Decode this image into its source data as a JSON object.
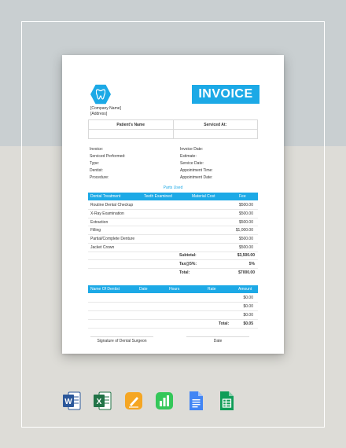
{
  "header": {
    "company_name": "[Company Name]",
    "address": "[Address]",
    "invoice_title": "INVOICE"
  },
  "patient_table": {
    "col1": "Patient's Name",
    "col2": "Serviced At:"
  },
  "info_left": [
    "Invoice:",
    "Serviced Performed:",
    "Type:",
    "Dentist:",
    "Procedure:"
  ],
  "info_right": [
    "Invoice Date:",
    "Estimate:",
    "Service Date:",
    "Appointment Time:",
    "Appointment Date:"
  ],
  "parts": {
    "title": "Parts Used",
    "headers": [
      "Dental Treatment",
      "Teeth Examined",
      "Material Cost",
      "Fee"
    ],
    "rows": [
      {
        "desc": "Routine Dental Checkup",
        "fee": "$500.00"
      },
      {
        "desc": "X-Ray Examination",
        "fee": "$500.00"
      },
      {
        "desc": "Extraction",
        "fee": "$500.00"
      },
      {
        "desc": "Filling",
        "fee": "$1,000.00"
      },
      {
        "desc": "Partial/Complete Denture",
        "fee": "$500.00"
      },
      {
        "desc": "Jacket Crown",
        "fee": "$500.00"
      }
    ],
    "subtotal_label": "Subtotal:",
    "subtotal": "$3,500.00",
    "tax_label": "Tax@5%:",
    "tax": "5%",
    "total_label": "Total:",
    "total": "$7000.00"
  },
  "dentist_table": {
    "headers": [
      "Name Of Dentist",
      "Date",
      "Hours",
      "Rate",
      "Amount"
    ],
    "amounts": [
      "$0.00",
      "$0.00",
      "$0.00"
    ],
    "total_label": "Total:",
    "total": "$0.05"
  },
  "signature": {
    "left": "Signature of Dental Surgeon",
    "right": "Date"
  },
  "apps": [
    "word-icon",
    "excel-icon",
    "pages-icon",
    "numbers-icon",
    "google-docs-icon",
    "google-sheets-icon"
  ],
  "colors": {
    "accent": "#1ca9e6",
    "word": "#2b579a",
    "excel": "#217346",
    "pages": "#f5a623",
    "numbers": "#34c759",
    "gdocs": "#4285f4",
    "gsheets": "#0f9d58"
  }
}
